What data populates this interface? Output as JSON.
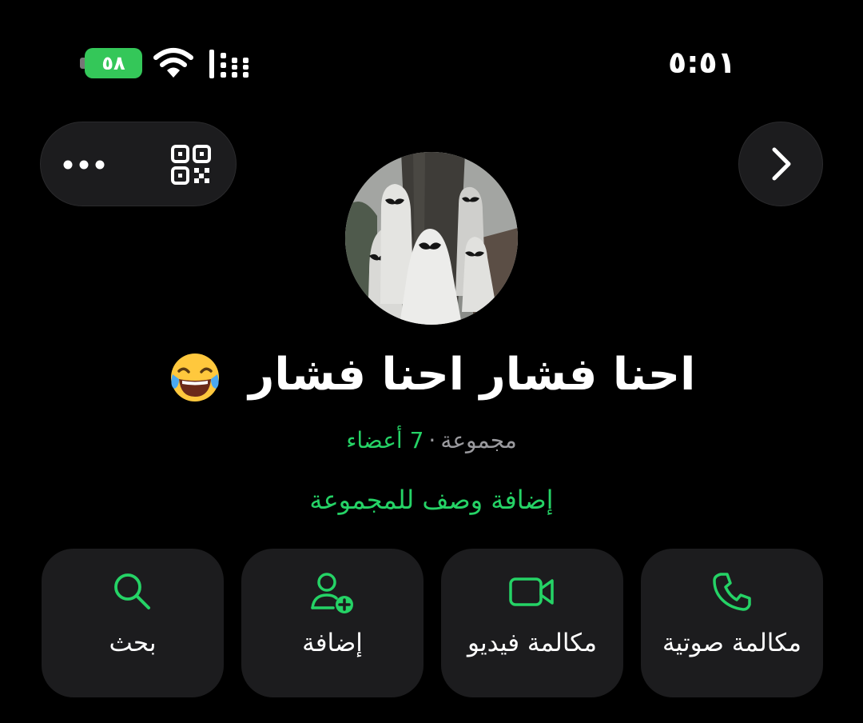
{
  "status_bar": {
    "time": "٥:٥١",
    "battery_level": "٥٨"
  },
  "group": {
    "title": "احنا فشار احنا فشار",
    "type_label": "مجموعة",
    "separator": "·",
    "members_label": "7 أعضاء",
    "add_description": "إضافة وصف للمجموعة"
  },
  "actions": [
    {
      "label": "مكالمة صوتية",
      "icon": "phone-icon"
    },
    {
      "label": "مكالمة فيديو",
      "icon": "video-camera-icon"
    },
    {
      "label": "إضافة",
      "icon": "add-person-icon"
    },
    {
      "label": "بحث",
      "icon": "search-icon"
    }
  ],
  "colors": {
    "background": "#000000",
    "surface": "#1c1c1e",
    "accent": "#25d366",
    "secondary_text": "#9a9a9e",
    "battery": "#34c759"
  }
}
